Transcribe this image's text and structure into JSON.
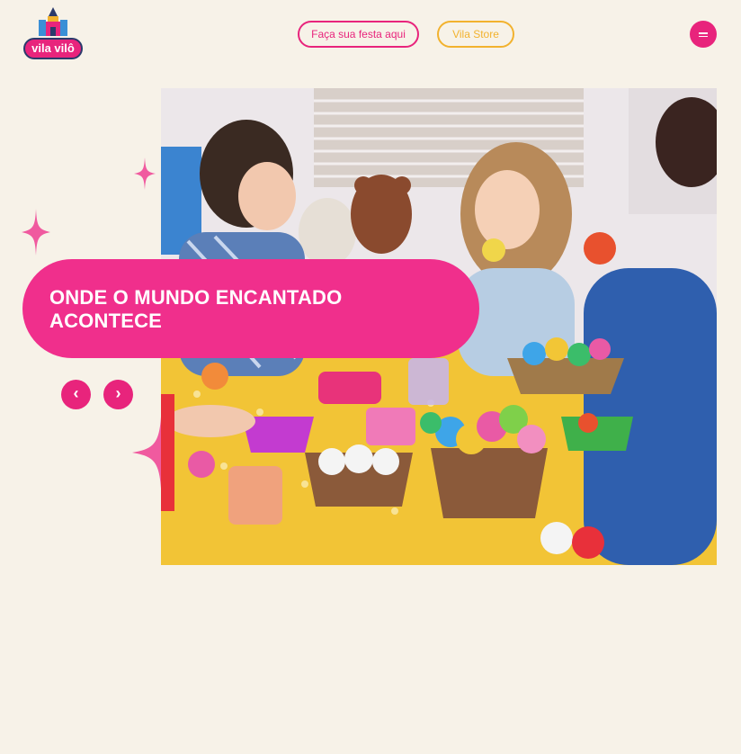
{
  "brand": {
    "name": "vila vilô",
    "color": "#e8247c"
  },
  "header": {
    "party_button": "Faça sua festa aqui",
    "store_button": "Vila Store",
    "menu_icon": "hamburger-icon"
  },
  "hero": {
    "title": "ONDE O MUNDO ENCANTADO ACONTECE",
    "prev_icon": "chevron-left-icon",
    "next_icon": "chevron-right-icon",
    "prev_glyph": "‹",
    "next_glyph": "›"
  },
  "colors": {
    "pink": "#e8247c",
    "hot_pink": "#f02f8c",
    "yellow": "#f2b22e",
    "background": "#f7f2e8"
  }
}
